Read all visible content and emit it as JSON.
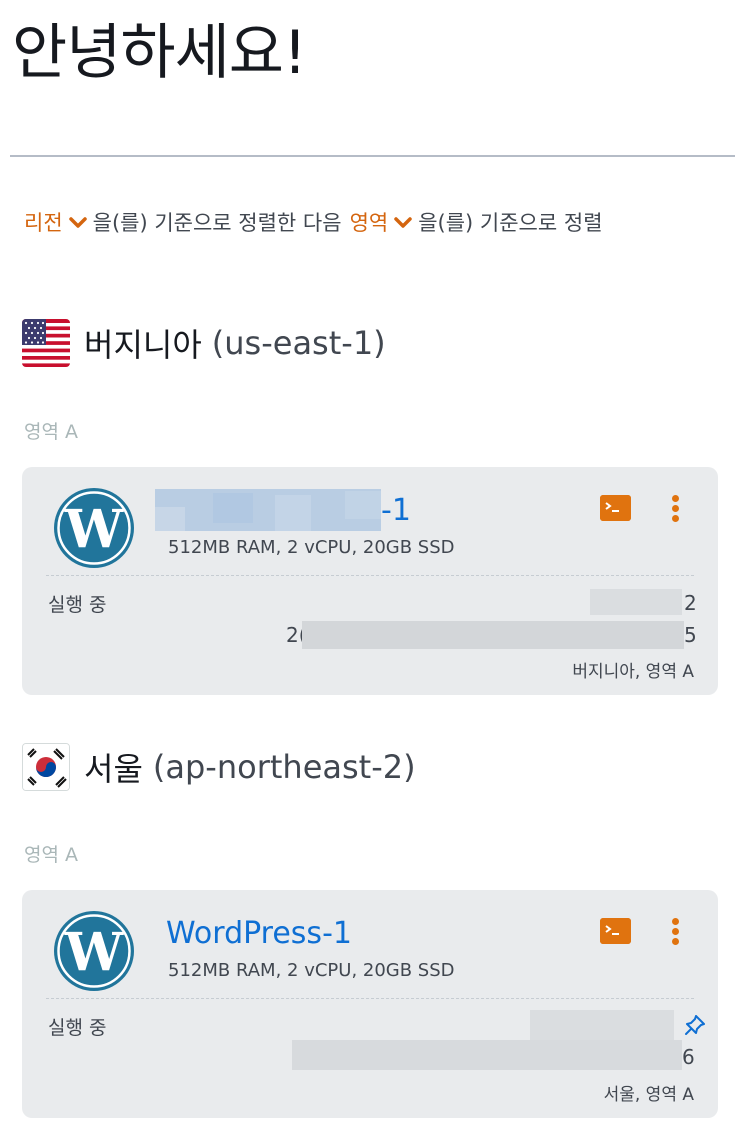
{
  "greeting": "안녕하세요!",
  "sort": {
    "field1": "리전",
    "connector1": "을(를) 기준으로 정렬한 다음",
    "field2": "영역",
    "connector2": "을(를) 기준으로 정렬"
  },
  "regions": [
    {
      "flag": "us-flag-icon",
      "name": "버지니아",
      "code": "(us-east-1)",
      "zone": "영역 A",
      "instance": {
        "name_suffix": "-1",
        "spec": "512MB RAM, 2 vCPU, 20GB SSD",
        "status": "실행 중",
        "ip_tail_1": "2",
        "ip_head_2": "2(",
        "ip_tail_2": "5",
        "location": "버지니아, 영역 A"
      }
    },
    {
      "flag": "kr-flag-icon",
      "name": "서울",
      "code": "(ap-northeast-2)",
      "zone": "영역 A",
      "instance": {
        "name": "WordPress-1",
        "spec": "512MB RAM, 2 vCPU, 20GB SSD",
        "status": "실행 중",
        "ip_tail_2": "6",
        "location": "서울, 영역 A"
      }
    }
  ],
  "icons": {
    "app_logo": "wordpress-logo-icon",
    "terminal": "terminal-icon",
    "menu": "kebab-menu-icon",
    "pin": "pin-icon",
    "sort_chevron": "chevron-down-icon"
  },
  "colors": {
    "accent_orange": "#e0730f",
    "link_blue": "#0f6fd3",
    "card_bg": "#e9ebed",
    "wordpress_blue": "#21759b"
  }
}
